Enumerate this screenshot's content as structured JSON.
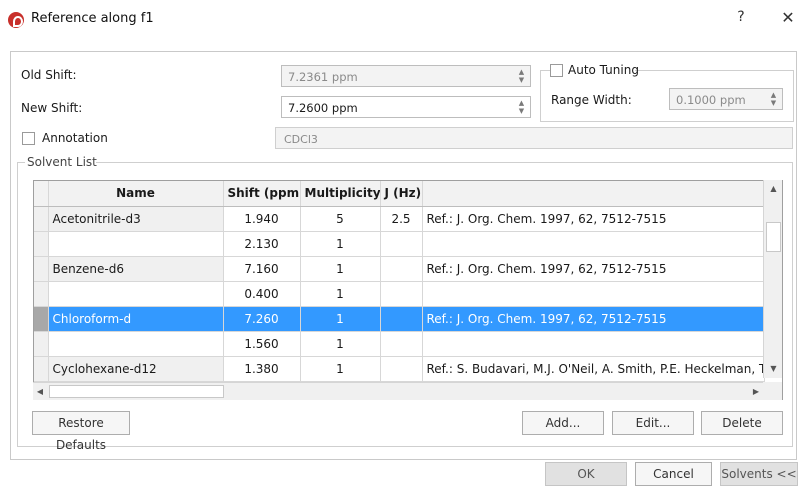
{
  "window": {
    "title": "Reference along f1",
    "help_label": "?",
    "close_label": "✕"
  },
  "shift": {
    "old_label": "Old Shift:",
    "old_value": "7.2361 ppm",
    "new_label": "New Shift:",
    "new_value": "7.2600 ppm"
  },
  "auto_tuning": {
    "label": "Auto Tuning",
    "checked": false,
    "range_label": "Range Width:",
    "range_value": "0.1000 ppm"
  },
  "annotation": {
    "label": "Annotation",
    "checked": false,
    "value": "CDCl3"
  },
  "solvent_list": {
    "group_label": "Solvent List",
    "columns": [
      "Name",
      "Shift (ppm)",
      "Multiplicity",
      "J (Hz)",
      ""
    ],
    "rows": [
      {
        "name": "Acetonitrile-d3",
        "shift": "1.940",
        "mult": "5",
        "j": "2.5",
        "ref": "Ref.: J. Org. Chem. 1997, 62, 7512-7515"
      },
      {
        "name": "",
        "shift": "2.130",
        "mult": "1",
        "j": "",
        "ref": ""
      },
      {
        "name": "Benzene-d6",
        "shift": "7.160",
        "mult": "1",
        "j": "",
        "ref": "Ref.: J. Org. Chem. 1997, 62, 7512-7515"
      },
      {
        "name": "",
        "shift": "0.400",
        "mult": "1",
        "j": "",
        "ref": ""
      },
      {
        "name": "Chloroform-d",
        "shift": "7.260",
        "mult": "1",
        "j": "",
        "ref": "Ref.: J. Org. Chem. 1997, 62, 7512-7515"
      },
      {
        "name": "",
        "shift": "1.560",
        "mult": "1",
        "j": "",
        "ref": ""
      },
      {
        "name": "Cyclohexane-d12",
        "shift": "1.380",
        "mult": "1",
        "j": "",
        "ref": "Ref.: S. Budavari, M.J. O'Neil, A. Smith, P.E. Heckelman, The"
      }
    ],
    "selected_index": 4
  },
  "buttons": {
    "restore_defaults": "Restore Defaults",
    "add": "Add...",
    "edit": "Edit...",
    "delete": "Delete",
    "ok": "OK",
    "cancel": "Cancel",
    "solvents": "Solvents <<"
  },
  "colors": {
    "selection": "#3399ff",
    "app_icon": "#c8302b"
  }
}
